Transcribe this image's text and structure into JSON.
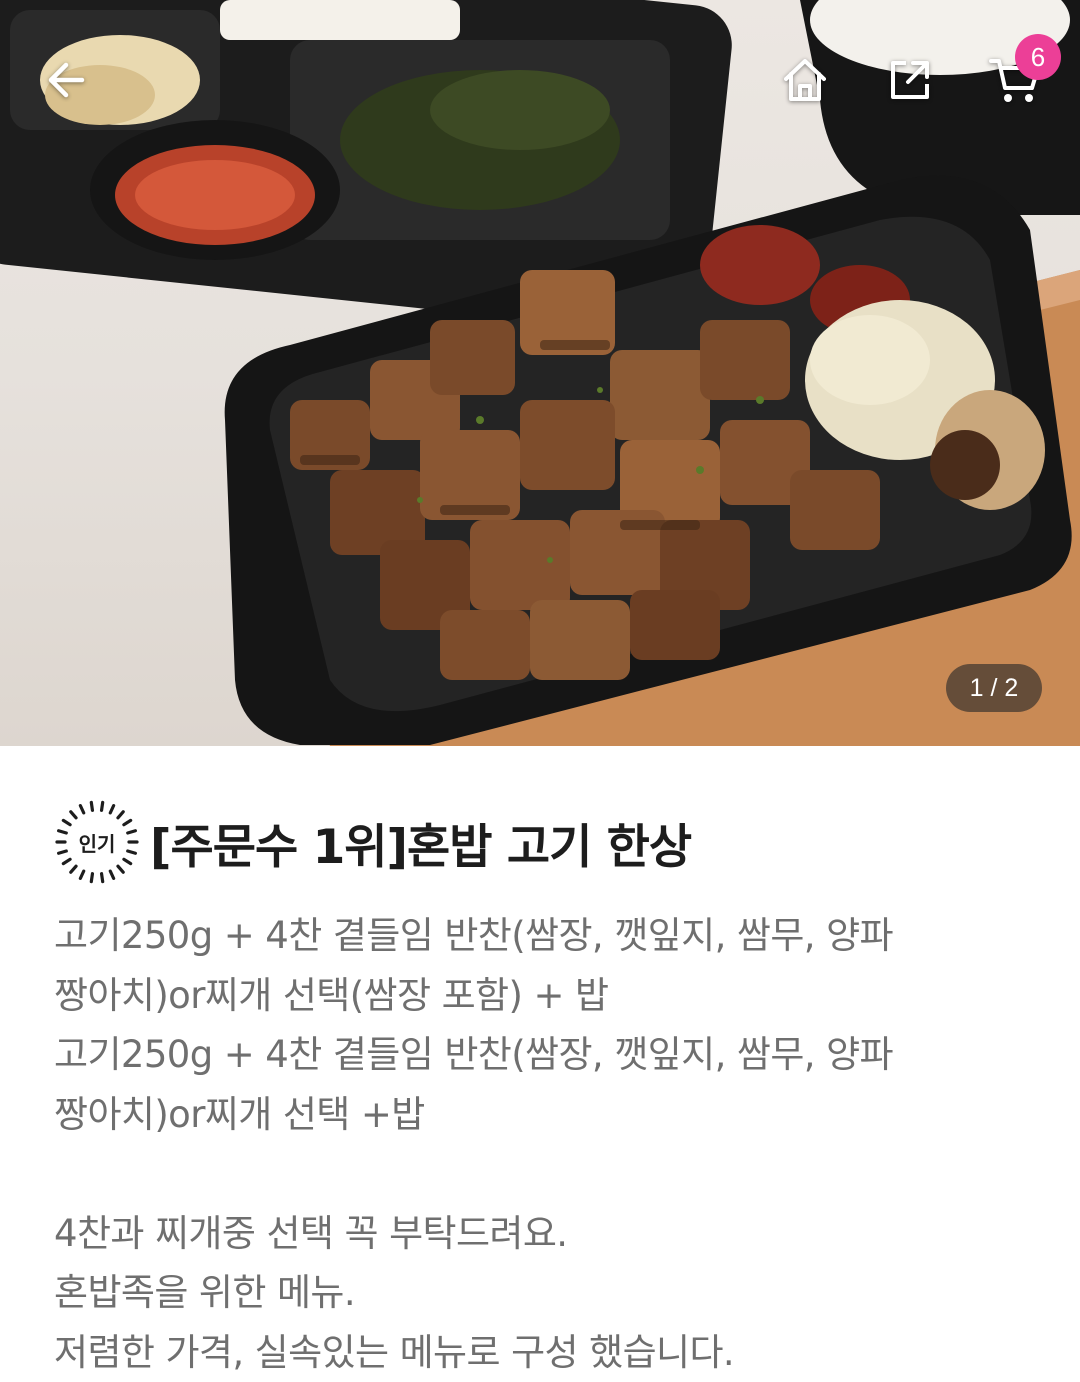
{
  "topbar": {
    "back_icon": "arrow-left-icon",
    "home_icon": "home-icon",
    "share_icon": "share-icon",
    "cart_icon": "cart-icon",
    "cart_count": "6",
    "badge_color": "#ec3f97"
  },
  "gallery": {
    "indicator": "1 / 2",
    "current": 1,
    "total": 2
  },
  "product": {
    "badge_label": "인기",
    "title": "[주문수 1위]혼밥 고기 한상",
    "description_lines": [
      "고기250g + 4찬 곁들임 반찬(쌈장, 깻잎지, 쌈무, 양파",
      "짱아치)or찌개 선택(쌈장 포함) + 밥",
      "고기250g + 4찬 곁들임 반찬(쌈장, 깻잎지, 쌈무, 양파",
      "짱아치)or찌개 선택 +밥",
      "",
      "4찬과 찌개중 선택 꼭 부탁드려요.",
      "혼밥족을 위한 메뉴.",
      "저렴한 가격, 실속있는 메뉴로 구성 했습니다."
    ]
  }
}
